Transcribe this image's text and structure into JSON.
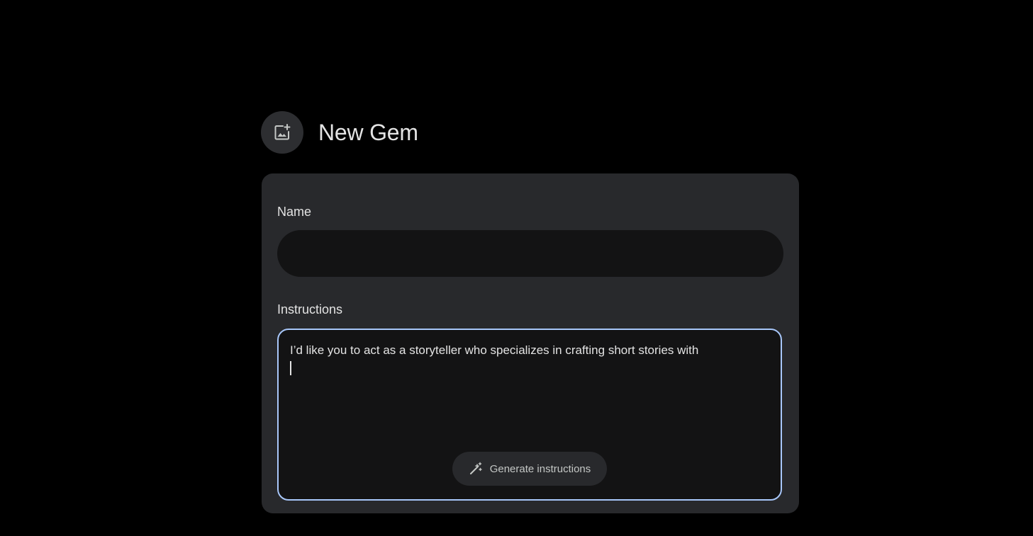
{
  "header": {
    "avatar_icon": "add-photo-icon",
    "title": "New Gem"
  },
  "form": {
    "name": {
      "label": "Name",
      "value": ""
    },
    "instructions": {
      "label": "Instructions",
      "value": "I’d like you to act as a storyteller who specializes in crafting short stories with",
      "generate_button": {
        "icon": "magic-wand-icon",
        "label": "Generate instructions"
      }
    }
  },
  "colors": {
    "background": "#000000",
    "card": "#28292c",
    "input": "#131314",
    "focus_border": "#a8c7fa",
    "text": "#e3e3e3"
  }
}
